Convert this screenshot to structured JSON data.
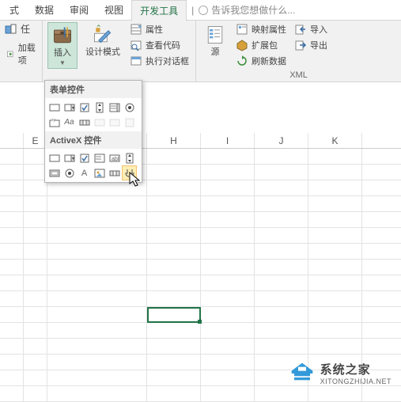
{
  "tabs": {
    "formulas_partial": "式",
    "data": "数据",
    "review": "审阅",
    "view": "视图",
    "developer": "开发工具",
    "tellme": "告诉我您想做什么..."
  },
  "ribbon": {
    "addins_group": {
      "addins_lbl": "加载项",
      "com_lbl_partial": "任"
    },
    "controls_group": {
      "insert": "插入",
      "design_mode": "设计模式",
      "properties": "属性",
      "view_code": "查看代码",
      "run_dialog": "执行对话框"
    },
    "source_group": {
      "source": "源",
      "map_props": "映射属性",
      "expansion": "扩展包",
      "refresh": "刷新数据",
      "import": "导入",
      "export": "导出",
      "label": "XML"
    }
  },
  "popup": {
    "form_title": "表单控件",
    "activex_title": "ActiveX 控件"
  },
  "columns": {
    "e": "E",
    "h": "H",
    "i": "I",
    "j": "J",
    "k": "K"
  },
  "watermark": {
    "zh": "系统之家",
    "en": "XITONGZHIJIA.NET"
  }
}
